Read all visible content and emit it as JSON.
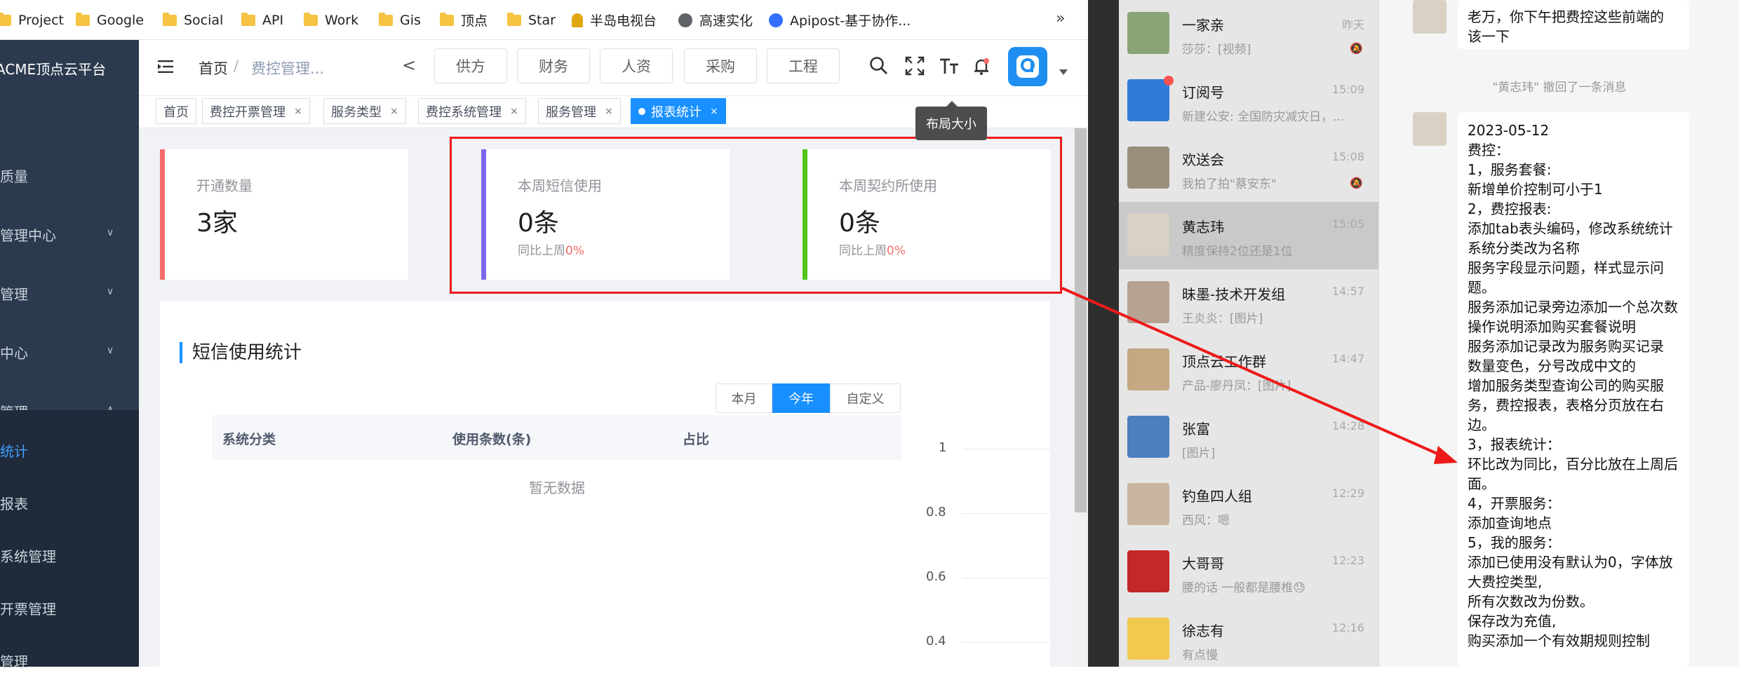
{
  "bookmarks": [
    {
      "label": "Project",
      "icon": "folder-icon"
    },
    {
      "label": "Google",
      "icon": "folder-icon"
    },
    {
      "label": "Social",
      "icon": "folder-icon"
    },
    {
      "label": "API",
      "icon": "folder-icon"
    },
    {
      "label": "Work",
      "icon": "folder-icon"
    },
    {
      "label": "Gis",
      "icon": "folder-icon"
    },
    {
      "label": "顶点",
      "icon": "folder-icon"
    },
    {
      "label": "Star",
      "icon": "folder-icon"
    },
    {
      "label": "半岛电视台",
      "icon": "site-icon"
    },
    {
      "label": "高速实化",
      "icon": "globe-icon"
    },
    {
      "label": "Apipost-基于协作...",
      "icon": "apipost-icon"
    }
  ],
  "bookmarks_more": "»",
  "sidebar": {
    "brand": "ACME顶点云平台",
    "items": [
      {
        "label": "质量",
        "chevron": ""
      },
      {
        "label": "管理中心",
        "chevron": "∨"
      },
      {
        "label": "管理",
        "chevron": "∨"
      },
      {
        "label": "中心",
        "chevron": "∨"
      },
      {
        "label": "管理",
        "chevron": "∧"
      }
    ],
    "sub_items": [
      "统计",
      "报表",
      "系统管理",
      "开票管理",
      "管理"
    ]
  },
  "header": {
    "breadcrumb_home": "首页",
    "breadcrumb_sep": "/",
    "breadcrumb_current": "费控管理...",
    "back_arrow": "<",
    "top_tabs": [
      "供方",
      "财务",
      "人资",
      "采购",
      "工程"
    ],
    "tooltip": "布局大小"
  },
  "tags": [
    "首页",
    "费控开票管理",
    "服务类型",
    "费控系统管理",
    "服务管理",
    "报表统计"
  ],
  "tag_close": "×",
  "stats": [
    {
      "label": "开通数量",
      "value": "3家",
      "compare_prefix": "",
      "compare_pct": "",
      "color": "#f56c6c"
    },
    {
      "label": "本周短信使用",
      "value": "0条",
      "compare_prefix": "同比上周",
      "compare_pct": "0%",
      "color": "#7b68ee"
    },
    {
      "label": "本周契约所使用",
      "value": "0条",
      "compare_prefix": "同比上周",
      "compare_pct": "0%",
      "color": "#52c41a"
    }
  ],
  "sms": {
    "title": "短信使用统计",
    "range_buttons": [
      "本月",
      "今年",
      "自定义"
    ],
    "columns": [
      "系统分类",
      "使用条数(条)",
      "占比"
    ],
    "empty": "暂无数据",
    "y_ticks": [
      "1",
      "0.8",
      "0.6",
      "0.4"
    ]
  },
  "chats": [
    {
      "name": "一家亲",
      "preview": "莎莎：[视频]",
      "time": "昨天",
      "muted": true,
      "avatar": "#8aa377"
    },
    {
      "name": "订阅号",
      "preview": "新建公安: 全国防灾减灾日，...",
      "time": "15:09",
      "muted": false,
      "avatar": "#2f7bd9"
    },
    {
      "name": "欢送会",
      "preview": "我拍了拍\"蔡安东\"",
      "time": "15:08",
      "muted": true,
      "avatar": "#9a8f7d"
    },
    {
      "name": "黄志玮",
      "preview": "精度保持2位还是1位",
      "time": "15:05",
      "muted": false,
      "avatar": "#d8d1c4"
    },
    {
      "name": "昧墨-技术开发组",
      "preview": "王炎炎：[图片]",
      "time": "14:57",
      "muted": false,
      "avatar": "#b7a292"
    },
    {
      "name": "顶点云工作群",
      "preview": "产品-廖丹凤：[图片]",
      "time": "14:47",
      "muted": false,
      "avatar": "#c4a882"
    },
    {
      "name": "张富",
      "preview": "[图片]",
      "time": "14:28",
      "muted": false,
      "avatar": "#4b7fbf"
    },
    {
      "name": "钓鱼四人组",
      "preview": "西风：嗯",
      "time": "12:29",
      "muted": false,
      "avatar": "#c9b6a0"
    },
    {
      "name": "大哥哥",
      "preview": "腰的话 一般都是腰椎😓",
      "time": "12:23",
      "muted": false,
      "avatar": "#c62828"
    },
    {
      "name": "徐志有",
      "preview": "有点慢",
      "time": "12:16",
      "muted": false,
      "avatar": "#f2c94c"
    }
  ],
  "chat_window": {
    "bubble1": [
      "老万，你下午把费控这些前端的",
      "该一下"
    ],
    "recall_notice": "\"黄志玮\" 撤回了一条消息",
    "bubble2": [
      "2023-05-12",
      "费控：",
      "1，服务套餐:",
      "新增单价控制可小于1",
      "2，费控报表:",
      "添加tab表头编码，修改系统统计系统分类改为名称",
      "服务字段显示问题，样式显示问题。",
      "服务添加记录旁边添加一个总次数",
      "操作说明添加购买套餐说明",
      "服务添加记录改为服务购买记录",
      "数量变色，分号改成中文的",
      "增加服务类型查询公司的购买服务，费控报表，表格分页放在右边。",
      "3，报表统计：",
      "环比改为同比，百分比放在上周后面。",
      "4，开票服务：",
      "添加查询地点",
      "5，我的服务：",
      "添加已使用没有默认为0，字体放大费控类型,",
      "所有次数改为份数。",
      "保存改为充值,",
      "购买添加一个有效期规则控制"
    ]
  },
  "colors": {
    "highlight": "#ee1a1a",
    "accent": "#1890ff",
    "sidebar": "#2b3a4e"
  }
}
